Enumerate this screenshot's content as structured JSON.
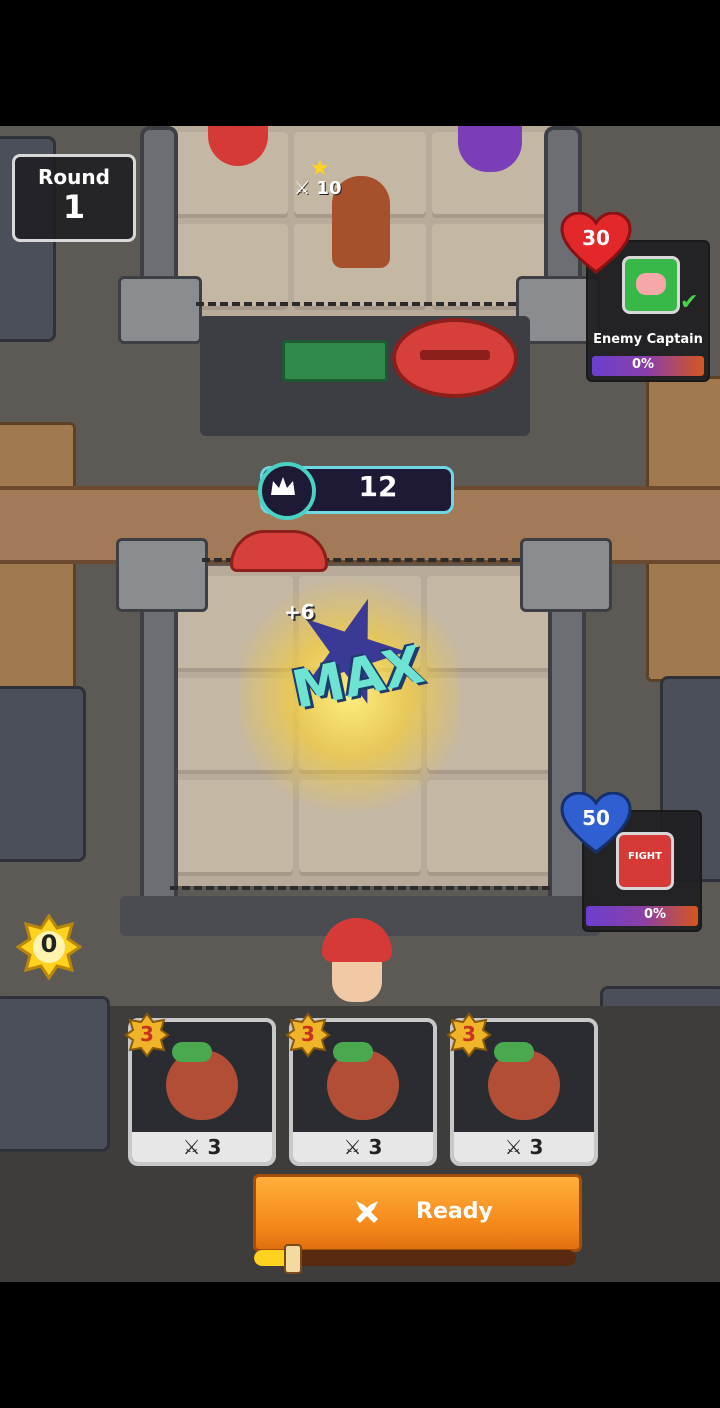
{
  "hud": {
    "round_label": "Round",
    "round_value": "1",
    "crown_value": "12",
    "coin_value": "0"
  },
  "enemy": {
    "hp": "30",
    "captain_name": "Enemy Captain",
    "percent": "0%",
    "unit_level": "10"
  },
  "player": {
    "hp": "50",
    "percent": "0%",
    "shield_text": "FIGHT"
  },
  "effect": {
    "max_text": "MAX",
    "plus_text": "+6"
  },
  "cards": [
    {
      "level": "3",
      "power": "3"
    },
    {
      "level": "3",
      "power": "3"
    },
    {
      "level": "3",
      "power": "3"
    }
  ],
  "ready_button": {
    "label": "Ready"
  },
  "progress": {
    "fraction": 0.12
  },
  "colors": {
    "accent_orange": "#f4861a",
    "enemy_heart": "#e3282c",
    "player_heart": "#2f5fd0",
    "crown_ring": "#4ad1c4"
  },
  "icons": [
    "crown-icon",
    "heart-icon",
    "check-icon",
    "sword-icon",
    "star-icon",
    "crossed-swords-icon",
    "coin-star-icon"
  ]
}
